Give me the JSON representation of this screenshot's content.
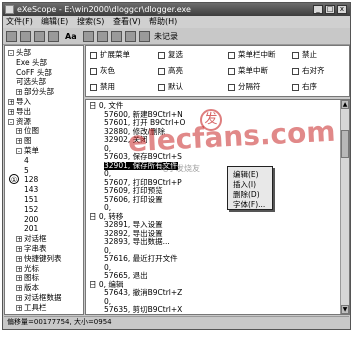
{
  "window": {
    "title": "eXeScope - E:\\win2000\\dloggcr\\dlogger.exe",
    "minimize_label": "_",
    "maximize_label": "□",
    "close_label": "x"
  },
  "menu": [
    "文件(F)",
    "编辑(E)",
    "搜索(S)",
    "查看(V)",
    "帮助(H)"
  ],
  "toolbar": {
    "aa_label": "Aa",
    "record_label": "未记录"
  },
  "tree": {
    "items": [
      {
        "text": "头部",
        "box": "-"
      },
      {
        "text": "Exe 头部",
        "box": ""
      },
      {
        "text": "CoFF 头部",
        "box": ""
      },
      {
        "text": "可选头部",
        "box": ""
      },
      {
        "text": "部分头部",
        "box": "+"
      },
      {
        "text": "导入",
        "box": "+"
      },
      {
        "text": "导出",
        "box": "+"
      },
      {
        "text": "资源",
        "box": "-"
      },
      {
        "text": "位图",
        "box": "+"
      },
      {
        "text": "图",
        "box": "+"
      },
      {
        "text": "菜单",
        "box": "-"
      },
      {
        "text": "4",
        "box": ""
      },
      {
        "text": "5",
        "box": ""
      },
      {
        "text": "128",
        "box": ""
      },
      {
        "text": "143",
        "box": ""
      },
      {
        "text": "151",
        "box": ""
      },
      {
        "text": "152",
        "box": ""
      },
      {
        "text": "200",
        "box": ""
      },
      {
        "text": "201",
        "box": ""
      },
      {
        "text": "对话框",
        "box": "+"
      },
      {
        "text": "字串表",
        "box": "+"
      },
      {
        "text": "快捷键列表",
        "box": "+"
      },
      {
        "text": "光标",
        "box": "+"
      },
      {
        "text": "图标",
        "box": "+"
      },
      {
        "text": "版本",
        "box": "+"
      },
      {
        "text": "对话框数据",
        "box": "+"
      },
      {
        "text": "工具栏",
        "box": "+"
      }
    ],
    "marker": "①"
  },
  "options": [
    [
      "扩展菜单",
      "复选",
      "菜单栏中断",
      "禁止"
    ],
    [
      "灰色",
      "高亮",
      "菜单中断",
      "右对齐"
    ],
    [
      "禁用",
      "默认",
      "分隔符",
      "右序"
    ]
  ],
  "list_items": [
    "日 0, 文件",
    "57600, 新建B9Ctrl+N",
    "57601, 打开     B9Ctrl+O",
    "32880, 修改/删除",
    "32902, 关闭",
    "0,",
    "57603, 保存B9Ctrl+S",
    "32901, 保存所有文件",
    "0,",
    "57607, 打印B9Ctrl+P",
    "57609, 打印预览",
    "57606, 打印设置",
    "0,",
    "日 0, 转移",
    "32891, 导入设置",
    "32892, 导出设置",
    "32893, 导出数据...",
    "0,",
    "57616, 最近打开文件",
    "0,",
    "57665, 退出",
    "日 0, 编辑",
    "57643, 撤消B9Ctrl+Z",
    "0,",
    "57635, 剪切B9Ctrl+X"
  ],
  "selected_index": 7,
  "context_menu": [
    "编辑(E)",
    "插入(I)",
    "删除(D)",
    "字体(F)..."
  ],
  "status": {
    "left": "偏移量=00177754, 大小=0954",
    "right": ""
  },
  "watermark": {
    "main": "elecfans.com",
    "mark": "发",
    "sub": "电子发烧友"
  }
}
